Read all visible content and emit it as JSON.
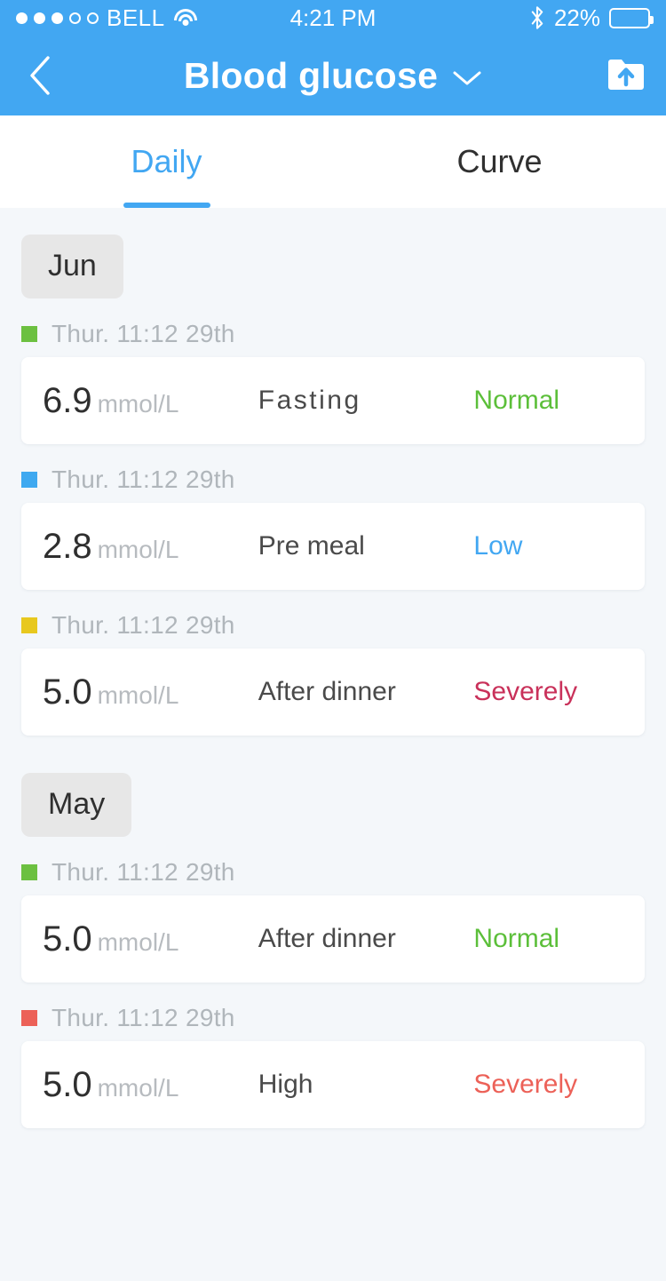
{
  "status_bar": {
    "signal_dots_filled": 3,
    "signal_dots_total": 5,
    "carrier": "BELL",
    "wifi_icon": "wifi-icon",
    "time": "4:21 PM",
    "bluetooth_icon": "bluetooth-icon",
    "battery_percent": "22%",
    "battery_level": 22
  },
  "header": {
    "back_icon": "chevron-left-icon",
    "title": "Blood glucose",
    "dropdown_icon": "chevron-down-icon",
    "upload_icon": "upload-folder-icon",
    "background_color": "#42a7f2"
  },
  "tabs": [
    {
      "label": "Daily",
      "active": true
    },
    {
      "label": "Curve",
      "active": false
    }
  ],
  "colors": {
    "accent": "#42a7f2",
    "normal": "#5cbf3a",
    "low": "#42a7f2",
    "severely_crimson": "#c9315a",
    "severely_red": "#ec6158",
    "marker_green": "#6cc040",
    "marker_blue": "#3fa9f0",
    "marker_yellow": "#e8c81e",
    "marker_red": "#ec6158",
    "page_background": "#f4f7fa"
  },
  "groups": [
    {
      "month": "Jun",
      "entries": [
        {
          "marker_color": "#6cc040",
          "date": "Thur. 11:12  29th",
          "value": "6.9",
          "unit": "mmol/L",
          "type": "Fasting",
          "status": "Normal",
          "status_color": "#5cbf3a"
        },
        {
          "marker_color": "#3fa9f0",
          "date": "Thur. 11:12  29th",
          "value": "2.8",
          "unit": "mmol/L",
          "type": "Pre meal",
          "status": "Low",
          "status_color": "#42a7f2"
        },
        {
          "marker_color": "#e8c81e",
          "date": "Thur. 11:12  29th",
          "value": "5.0",
          "unit": "mmol/L",
          "type": "After dinner",
          "status": "Severely",
          "status_color": "#c9315a"
        }
      ]
    },
    {
      "month": "May",
      "entries": [
        {
          "marker_color": "#6cc040",
          "date": "Thur. 11:12  29th",
          "value": "5.0",
          "unit": "mmol/L",
          "type": "After dinner",
          "status": "Normal",
          "status_color": "#5cbf3a"
        },
        {
          "marker_color": "#ec6158",
          "date": "Thur. 11:12  29th",
          "value": "5.0",
          "unit": "mmol/L",
          "type": "High",
          "status": "Severely",
          "status_color": "#ec6158"
        }
      ]
    }
  ]
}
